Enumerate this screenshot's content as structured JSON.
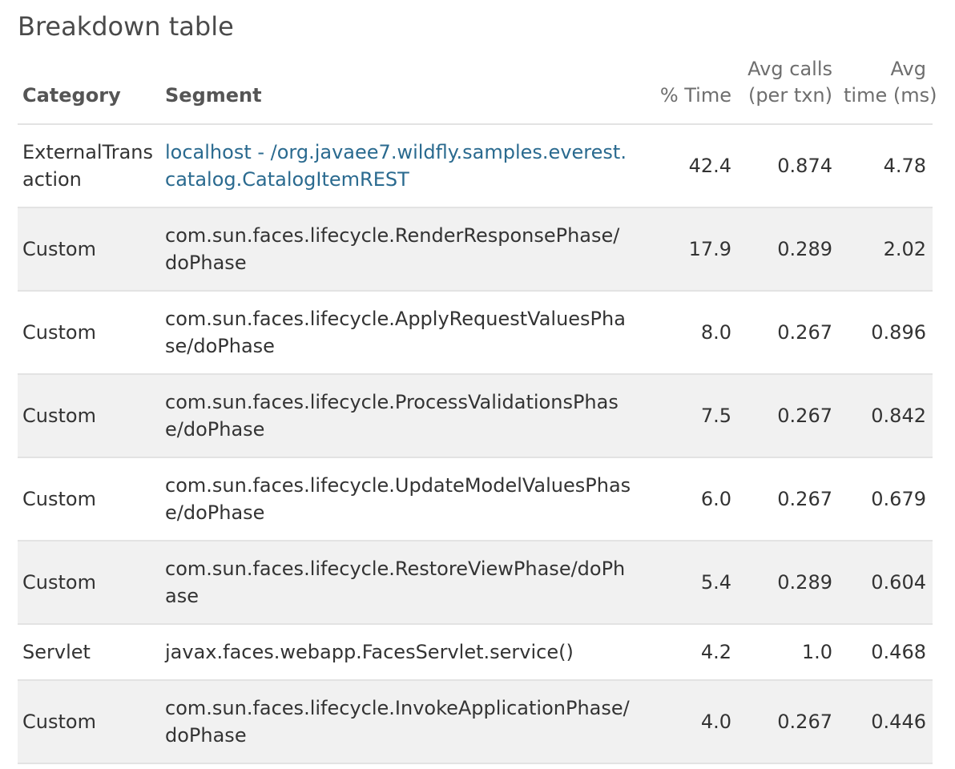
{
  "title": "Breakdown table",
  "columns": {
    "category": "Category",
    "segment": "Segment",
    "pct_time": "% Time",
    "avg_calls_line1": "Avg calls",
    "avg_calls_line2": "(per txn)",
    "avg_time_line1": "Avg",
    "avg_time_line2": "time (ms)"
  },
  "rows": [
    {
      "category": "ExternalTrans action",
      "segment": "localhost - /org.javaee7.wildfly.samples.everest.catalog.CatalogItemREST",
      "segment_is_link": true,
      "pct_time": "42.4",
      "avg_calls": "0.874",
      "avg_time": "4.78"
    },
    {
      "category": "Custom",
      "segment": "com.sun.faces.lifecycle.RenderResponsePhase/ doPhase",
      "segment_is_link": false,
      "pct_time": "17.9",
      "avg_calls": "0.289",
      "avg_time": "2.02"
    },
    {
      "category": "Custom",
      "segment": "com.sun.faces.lifecycle.ApplyRequestValuesPhase/doPhase",
      "segment_is_link": false,
      "pct_time": "8.0",
      "avg_calls": "0.267",
      "avg_time": "0.896"
    },
    {
      "category": "Custom",
      "segment": "com.sun.faces.lifecycle.ProcessValidationsPhase/doPhase",
      "segment_is_link": false,
      "pct_time": "7.5",
      "avg_calls": "0.267",
      "avg_time": "0.842"
    },
    {
      "category": "Custom",
      "segment": "com.sun.faces.lifecycle.UpdateModelValuesPhase/doPhase",
      "segment_is_link": false,
      "pct_time": "6.0",
      "avg_calls": "0.267",
      "avg_time": "0.679"
    },
    {
      "category": "Custom",
      "segment": "com.sun.faces.lifecycle.RestoreViewPhase/doPhase",
      "segment_is_link": false,
      "pct_time": "5.4",
      "avg_calls": "0.289",
      "avg_time": "0.604"
    },
    {
      "category": "Servlet",
      "segment": "javax.faces.webapp.FacesServlet.service()",
      "segment_is_link": false,
      "pct_time": "4.2",
      "avg_calls": "1.0",
      "avg_time": "0.468"
    },
    {
      "category": "Custom",
      "segment": "com.sun.faces.lifecycle.InvokeApplicationPhase/ doPhase",
      "segment_is_link": false,
      "pct_time": "4.0",
      "avg_calls": "0.267",
      "avg_time": "0.446"
    }
  ],
  "colors": {
    "link": "#2a6a8f",
    "stripe": "#f1f1f1",
    "divider": "#e3e3e3"
  }
}
